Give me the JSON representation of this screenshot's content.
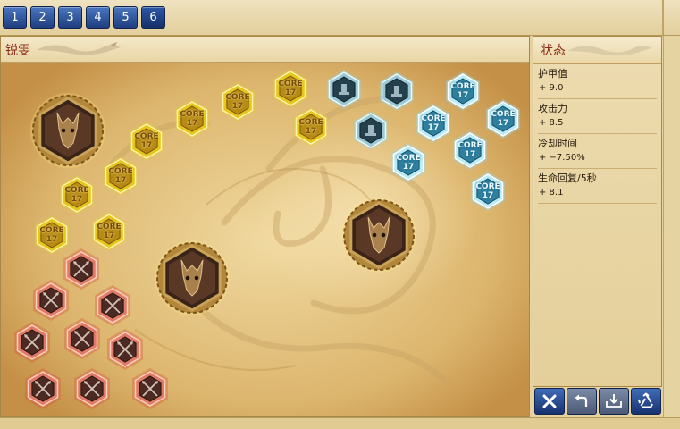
{
  "page_tabs": [
    "1",
    "2",
    "3",
    "4",
    "5",
    "6"
  ],
  "tree": {
    "title": "锐雯"
  },
  "stats": {
    "title": "状态",
    "items": [
      {
        "name": "护甲值",
        "value": "+ 9.0"
      },
      {
        "name": "攻击力",
        "value": "+ 8.5"
      },
      {
        "name": "冷却时间",
        "value": "+ −7.50%"
      },
      {
        "name": "生命回复/5秒",
        "value": "+ 8.1"
      }
    ]
  },
  "actions": [
    {
      "name": "clear-button",
      "icon": "x-icon"
    },
    {
      "name": "undo-button",
      "icon": "undo-arrow-icon"
    },
    {
      "name": "save-button",
      "icon": "download-tray-icon"
    },
    {
      "name": "reset-button",
      "icon": "recycle-icon"
    }
  ],
  "node_label": {
    "line1": "CORE",
    "line2": "17"
  },
  "colors": {
    "gold": "#e8cf2a",
    "blue": "#8fd8ee",
    "red": "#d8513a",
    "button_blue": "#2a4f95",
    "title_red": "#8a2a14"
  }
}
